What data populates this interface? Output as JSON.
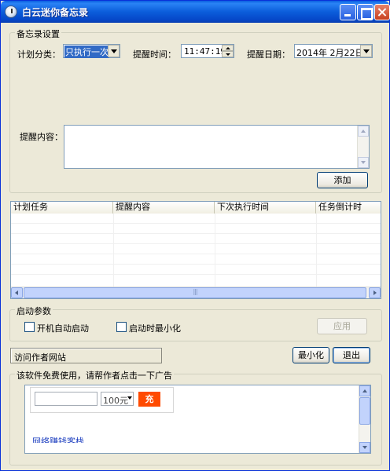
{
  "window": {
    "title": "白云迷你备忘录"
  },
  "settings": {
    "group_label": "备忘录设置",
    "category_label": "计划分类：",
    "category_value": "只执行一次",
    "time_label": "提醒时间：",
    "time_value": "11:47:19",
    "date_label": "提醒日期：",
    "date_value": "2014年 2月22日",
    "content_label": "提醒内容：",
    "content_value": "",
    "add_button": "添加"
  },
  "tasks": {
    "columns": [
      "计划任务",
      "提醒内容",
      "下次执行时间",
      "任务倒计时"
    ],
    "rows": []
  },
  "startup": {
    "group_label": "启动参数",
    "autostart_label": "开机自动启动",
    "autostart_checked": false,
    "minimize_label": "启动时最小化",
    "minimize_checked": false,
    "apply_button": "应用"
  },
  "footer": {
    "visit_author": "访问作者网站",
    "minimize_button": "最小化",
    "exit_button": "退出"
  },
  "ad": {
    "group_label": "该软件免费使用，请帮作者点击一下广告",
    "amount_value": "100元",
    "charge_button": "充",
    "link_text": "网络赚钱客栈"
  },
  "colors": {
    "titlebar": "#0a5fe0",
    "window_bg": "#ece9d8",
    "ad_button": "#ff4a00",
    "link": "#1a3cbf"
  }
}
